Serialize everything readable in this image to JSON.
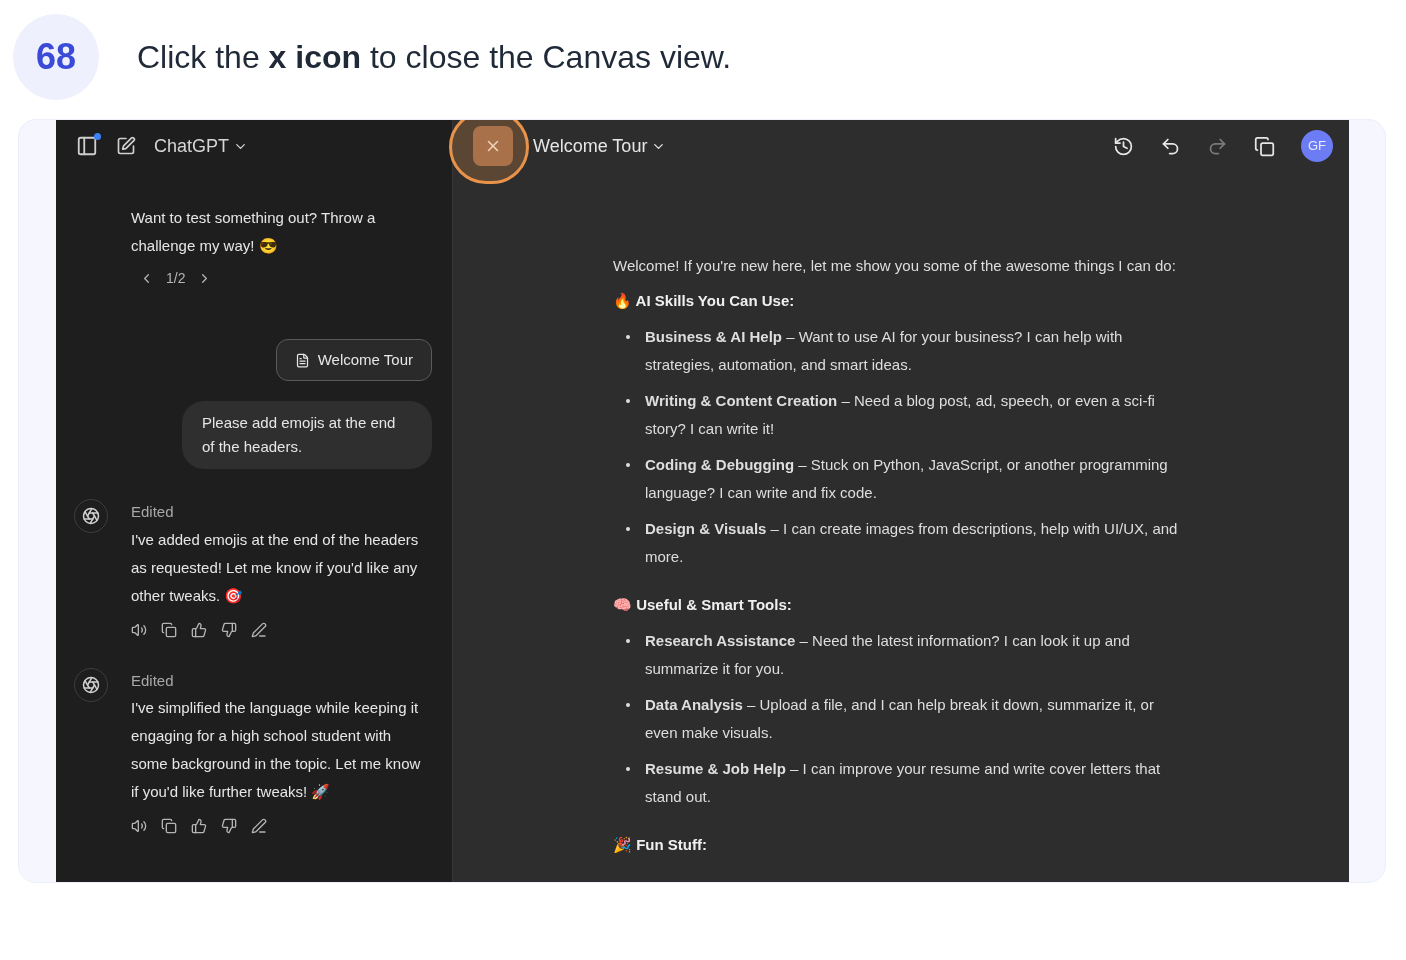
{
  "step": {
    "number": "68",
    "instruction": "Click the **x icon** to close the Canvas view."
  },
  "chat": {
    "title": "ChatGPT",
    "messages": [
      {
        "kind": "assistant",
        "text": "Want to test something out? Throw a challenge my way! 😎",
        "pager": "1/2"
      },
      {
        "kind": "attachment",
        "text": "Welcome Tour"
      },
      {
        "kind": "user",
        "text": "Please add emojis at the end of the headers."
      },
      {
        "kind": "edited",
        "label": "Edited",
        "text": "I've added emojis at the end of the headers as requested! Let me know if you'd like any other tweaks. 🎯"
      },
      {
        "kind": "edited",
        "label": "Edited",
        "text": "I've simplified the language while keeping it engaging for a high school student with some background in the topic. Let me know if you'd like further tweaks! 🚀"
      }
    ]
  },
  "canvas": {
    "title": "Welcome Tour",
    "toolbar": [
      {
        "kind": "history",
        "disabled": false
      },
      {
        "kind": "undo",
        "disabled": false
      },
      {
        "kind": "redo",
        "disabled": true
      },
      {
        "kind": "copy",
        "disabled": false
      }
    ],
    "avatar": "GF",
    "intro": "Welcome! If you're new here, let me show you some of the awesome things I can do:",
    "sections": [
      {
        "heading": "🔥 AI Skills You Can Use:",
        "items": [
          "**Business & AI Help** – Want to use AI for your business? I can help with strategies, automation, and smart ideas.",
          "**Writing & Content Creation** – Need a blog post, ad, speech, or even a sci-fi story? I can write it!",
          "**Coding & Debugging** – Stuck on Python, JavaScript, or another programming language? I can write and fix code.",
          "**Design & Visuals** – I can create images from descriptions, help with UI/UX, and more."
        ]
      },
      {
        "heading": "🧠 Useful & Smart Tools:",
        "items": [
          "**Research Assistance** – Need the latest information? I can look it up and summarize it for you.",
          "**Data Analysis** – Upload a file, and I can help break it down, summarize it, or even make visuals.",
          "**Resume & Job Help** – I can improve your resume and write cover letters that stand out."
        ]
      },
      {
        "heading": "🎉 Fun Stuff:"
      }
    ]
  }
}
